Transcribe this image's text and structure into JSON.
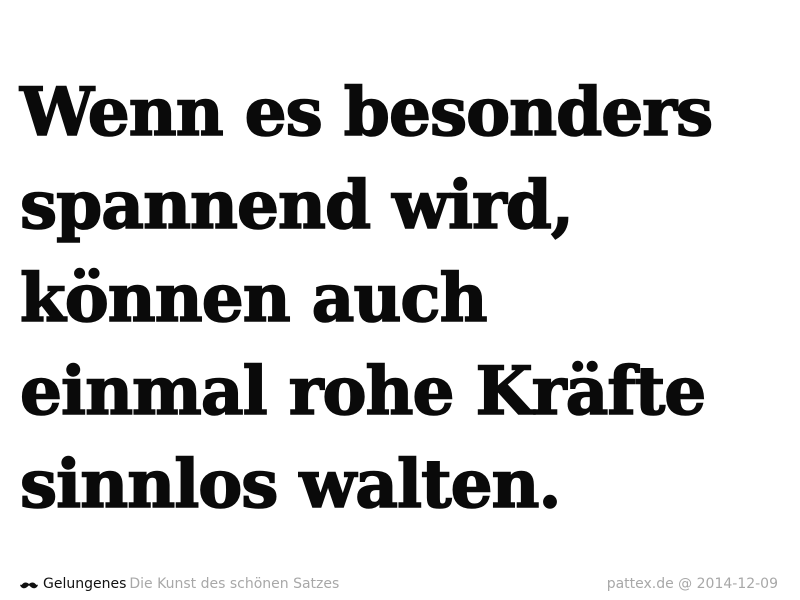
{
  "quote": {
    "lines": [
      "Wenn es besonders",
      "spannend wird,",
      "können auch",
      "einmal rohe Kräfte",
      "sinnlos walten."
    ]
  },
  "footer": {
    "icon": "mustache-icon",
    "brand": "Gelungenes",
    "tagline": "Die Kunst des schönen Satzes",
    "credit": "pattex.de @ 2014-12-09"
  },
  "colors": {
    "text": "#0a0a0a",
    "muted": "#a8a8a8",
    "background": "#ffffff"
  }
}
